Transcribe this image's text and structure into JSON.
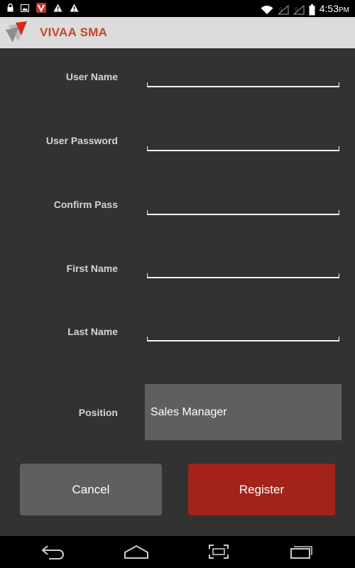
{
  "status_bar": {
    "time": "4:53",
    "time_suffix": "PM",
    "icons_left": [
      "lock-icon",
      "image-icon",
      "vivaa-app-icon",
      "warning-icon",
      "warning-icon"
    ],
    "icons_right": [
      "wifi-icon",
      "cellular-signal-icon",
      "cellular-signal-icon",
      "battery-icon"
    ]
  },
  "app_bar": {
    "title": "VIVAA SMA",
    "title_color": "#c8452a"
  },
  "form": {
    "fields": [
      {
        "label": "User Name",
        "value": ""
      },
      {
        "label": "User Password",
        "value": ""
      },
      {
        "label": "Confirm Pass",
        "value": ""
      },
      {
        "label": "First Name",
        "value": ""
      },
      {
        "label": "Last Name",
        "value": ""
      }
    ],
    "position": {
      "label": "Position",
      "selected": "Sales Manager"
    }
  },
  "buttons": {
    "cancel": "Cancel",
    "register": "Register",
    "register_color": "#a3231a"
  },
  "nav_bar": {
    "icons": [
      "back-icon",
      "home-icon",
      "screenshot-icon",
      "recent-apps-icon"
    ]
  }
}
